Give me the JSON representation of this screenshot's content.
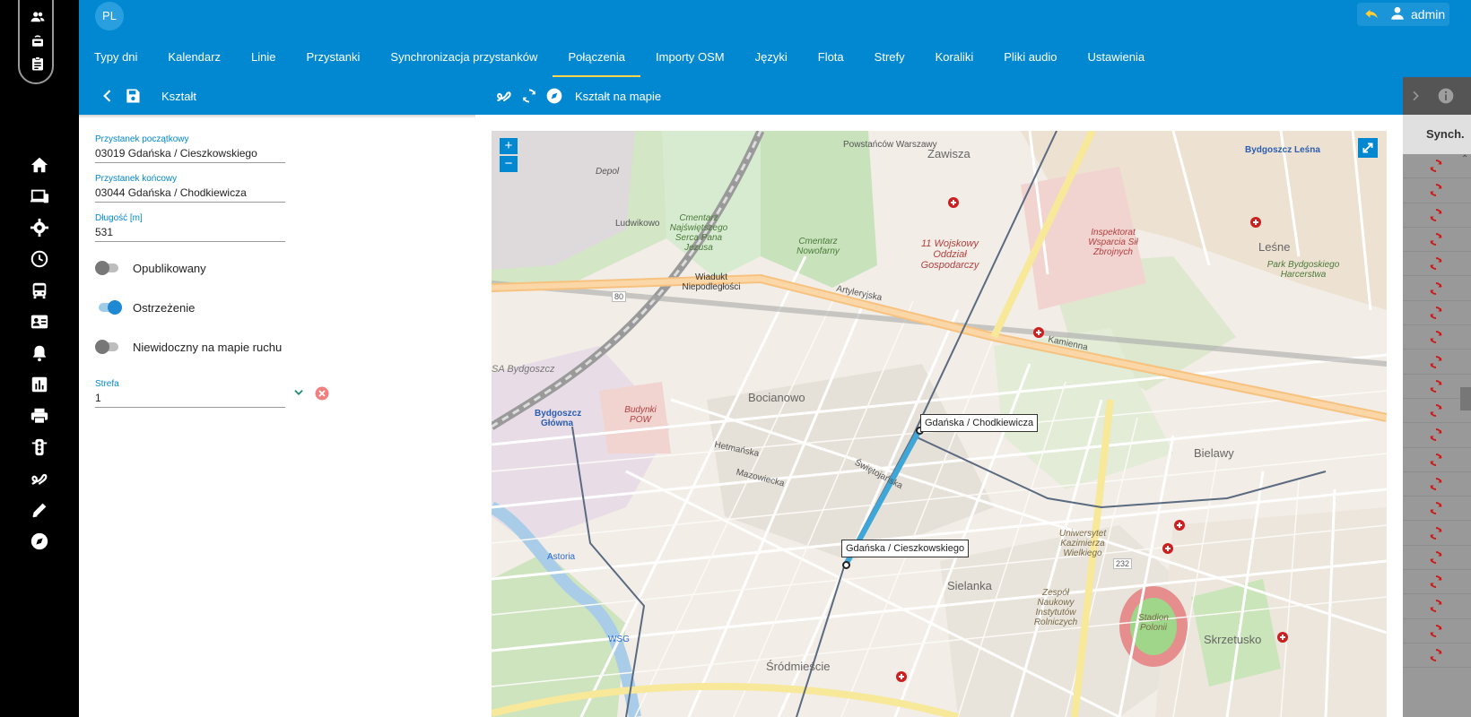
{
  "top_bar": {
    "lang": "PL",
    "user": "admin"
  },
  "tabs": [
    {
      "label": "Typy dni",
      "active": false
    },
    {
      "label": "Kalendarz",
      "active": false
    },
    {
      "label": "Linie",
      "active": false
    },
    {
      "label": "Przystanki",
      "active": false
    },
    {
      "label": "Synchronizacja przystanków",
      "active": false
    },
    {
      "label": "Połączenia",
      "active": true
    },
    {
      "label": "Importy OSM",
      "active": false
    },
    {
      "label": "Języki",
      "active": false
    },
    {
      "label": "Flota",
      "active": false
    },
    {
      "label": "Strefy",
      "active": false
    },
    {
      "label": "Koraliki",
      "active": false
    },
    {
      "label": "Pliki audio",
      "active": false
    },
    {
      "label": "Ustawienia",
      "active": false
    }
  ],
  "subbar": {
    "title": "Kształt",
    "map_title": "Kształt na mapie"
  },
  "form": {
    "start_stop": {
      "label": "Przystanek początkowy",
      "value": "03019 Gdańska / Cieszkowskiego"
    },
    "end_stop": {
      "label": "Przystanek końcowy",
      "value": "03044 Gdańska / Chodkiewicza"
    },
    "length": {
      "label": "Długość [m]",
      "value": "531"
    },
    "toggles": [
      {
        "label": "Opublikowany",
        "on": false
      },
      {
        "label": "Ostrzeżenie",
        "on": true
      },
      {
        "label": "Niewidoczny na mapie ruchu",
        "on": false
      }
    ],
    "zone": {
      "label": "Strefa",
      "value": "1"
    }
  },
  "right_panel": {
    "header": "Synch.",
    "sync_row_count": 21
  },
  "map": {
    "zoom_in": "+",
    "zoom_out": "−",
    "stop_labels": [
      "Gdańska / Chodkiewicza",
      "Gdańska / Cieszkowskiego"
    ],
    "place_labels": [
      "Zawisza",
      "Powstańców Warszawy",
      "Bydgoszcz Leśna",
      "Leśne",
      "Park Bydgoskiego Harcerstwa",
      "11 Wojskowy Oddział Gospodarczy",
      "Inspektorat Wsparcia Sił Zbrojnych",
      "Cmentarz Nowofarny",
      "Cmentarz Najświętszego Serca Pana Jezusa",
      "Wiadukt Niepodległości",
      "Artyleryjska",
      "Kamienna",
      "Bocianowo",
      "Budynki POW",
      "Bydgoszcz Główna",
      "Hetmańska",
      "Bielawy",
      "Sielanka",
      "Uniwersytet Kazimierza Wielkiego",
      "Zespół Naukowy Instytutów Rolniczych",
      "Stadion Polonii",
      "Skrzetusko",
      "Śródmieście",
      "Astoria",
      "WSG",
      "Depol",
      "Ludwikowo",
      "SA Bydgoszcz",
      "Mazowiecka",
      "Świętojańska",
      "80",
      "232"
    ]
  }
}
